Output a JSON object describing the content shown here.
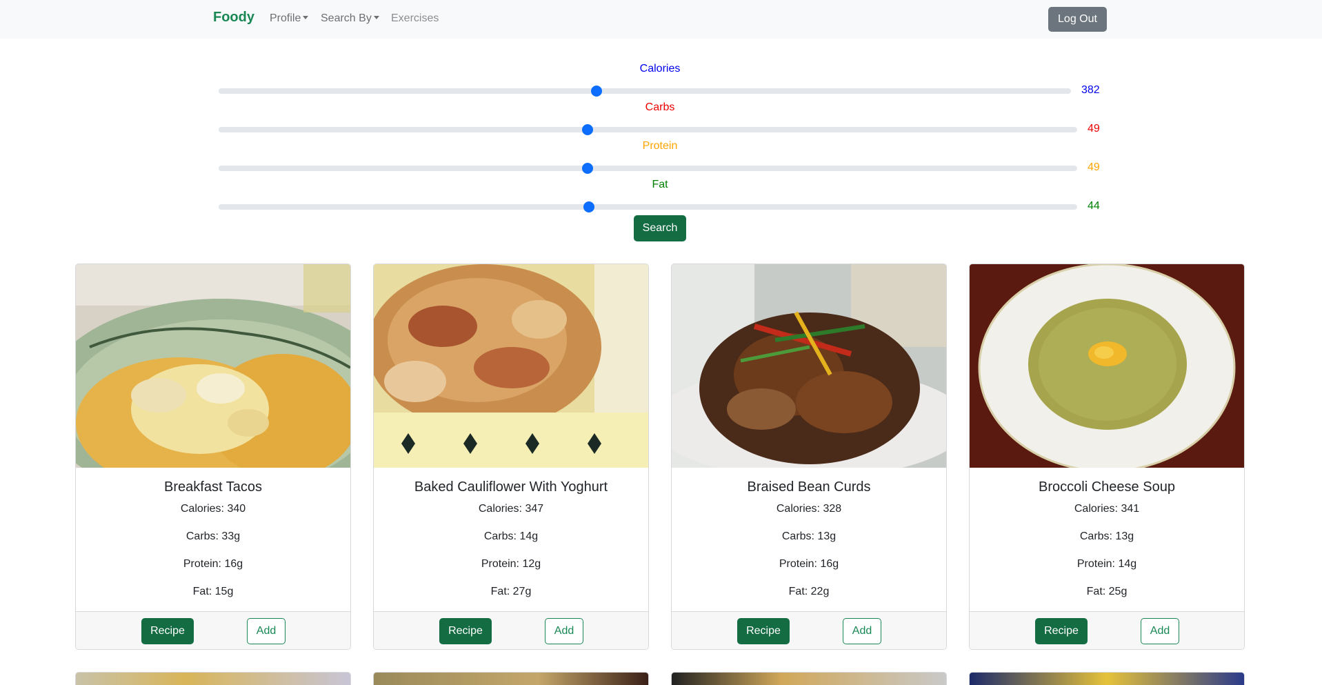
{
  "navbar": {
    "brand": "Foody",
    "links": [
      {
        "label": "Profile",
        "dropdown": true
      },
      {
        "label": "Search By",
        "dropdown": true
      },
      {
        "label": "Exercises",
        "dropdown": false
      }
    ],
    "logout_label": "Log Out"
  },
  "sliders": [
    {
      "label": "Calories",
      "value": "382",
      "color": "#0000ee",
      "fraction": 0.443
    },
    {
      "label": "Carbs",
      "value": "49",
      "color": "#ee0000",
      "fraction": 0.43
    },
    {
      "label": "Protein",
      "value": "49",
      "color": "#ffa500",
      "fraction": 0.43
    },
    {
      "label": "Fat",
      "value": "44",
      "color": "#008000",
      "fraction": 0.431
    }
  ],
  "search_label": "Search",
  "cards": [
    {
      "title": "Breakfast Tacos",
      "calories": "Calories: 340",
      "carbs": "Carbs: 33g",
      "protein": "Protein: 16g",
      "fat": "Fat: 15g",
      "recipe_label": "Recipe",
      "add_label": "Add",
      "image": "breakfast-tacos-photo"
    },
    {
      "title": "Baked Cauliflower With Yoghurt",
      "calories": "Calories: 347",
      "carbs": "Carbs: 14g",
      "protein": "Protein: 12g",
      "fat": "Fat: 27g",
      "recipe_label": "Recipe",
      "add_label": "Add",
      "image": "baked-cauliflower-photo"
    },
    {
      "title": "Braised Bean Curds",
      "calories": "Calories: 328",
      "carbs": "Carbs: 13g",
      "protein": "Protein: 16g",
      "fat": "Fat: 22g",
      "recipe_label": "Recipe",
      "add_label": "Add",
      "image": "braised-bean-curds-photo"
    },
    {
      "title": "Broccoli Cheese Soup",
      "calories": "Calories: 341",
      "carbs": "Carbs: 13g",
      "protein": "Protein: 14g",
      "fat": "Fat: 25g",
      "recipe_label": "Recipe",
      "add_label": "Add",
      "image": "broccoli-cheese-soup-photo"
    }
  ],
  "colors": {
    "brand": "#198754",
    "primary_button": "#146c43",
    "secondary_button": "#6c757d",
    "slider_thumb": "#0d6efd"
  }
}
